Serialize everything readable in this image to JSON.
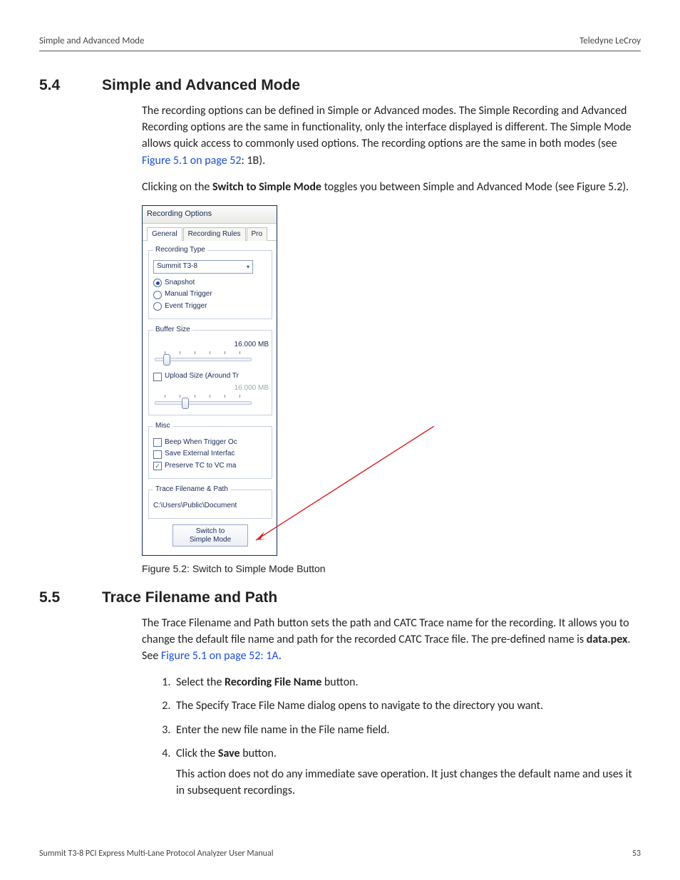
{
  "header": {
    "left": "Simple and Advanced Mode",
    "right": "Teledyne LeCroy"
  },
  "sec54": {
    "num": "5.4",
    "title": "Simple and Advanced Mode",
    "p1a": "The recording options can be defined in Simple or Advanced modes. The Simple Recording and Advanced Recording options are the same in functionality, only the interface displayed is different. The Simple Mode allows quick access to commonly used options. The recording options are the same in both modes (see ",
    "p1link": "Figure 5.1 on page 52",
    "p1b": ": 1B).",
    "p2a": "Clicking on the ",
    "p2bold": "Switch to Simple Mode",
    "p2b": " toggles you between Simple and Advanced Mode (see Figure 5.2)."
  },
  "shot": {
    "title": "Recording Options",
    "tab1": "General",
    "tab2": "Recording Rules",
    "tab3": "Pro",
    "grp_rectype": "Recording Type",
    "dd_value": "Summit T3-8",
    "r_snapshot": "Snapshot",
    "r_manual": "Manual Trigger",
    "r_event": "Event Trigger",
    "grp_buf": "Buffer Size",
    "buf_val": "16.000 MB",
    "c_upload": "Upload Size (Around Tr",
    "up_val": "16.000 MB",
    "grp_misc": "Misc",
    "c_beep": "Beep When Trigger Oc",
    "c_saveext": "Save External Interfac",
    "c_preserve": "Preserve TC to VC ma",
    "grp_path": "Trace Filename & Path",
    "path_val": "C:\\Users\\Public\\Document",
    "btn_line1": "Switch to",
    "btn_line2": "Simple Mode"
  },
  "caption52": "Figure 5.2:  Switch to Simple Mode Button",
  "sec55": {
    "num": "5.5",
    "title": "Trace Filename and Path",
    "p1a": "The Trace Filename and Path button sets the path and CATC Trace name for the recording. It allows you to change the default file name and path for the recorded CATC Trace file. The pre-defined name is ",
    "p1bold": "data.pex",
    "p1b": ". See ",
    "p1link": "Figure 5.1 on page 52: 1A",
    "p1c": ".",
    "s1a": "Select the ",
    "s1b": "Recording File Name",
    "s1c": " button.",
    "s2": "The Specify Trace File Name dialog opens to navigate to the directory you want.",
    "s3": "Enter the new file name in the File name field.",
    "s4a": "Click the ",
    "s4b": "Save",
    "s4c": " button.",
    "s4p": "This action does not do any immediate save operation. It just changes the default name and uses it in subsequent recordings."
  },
  "footer": {
    "left": "Summit T3-8 PCI Express Multi-Lane Protocol Analyzer User Manual",
    "right": "53"
  }
}
